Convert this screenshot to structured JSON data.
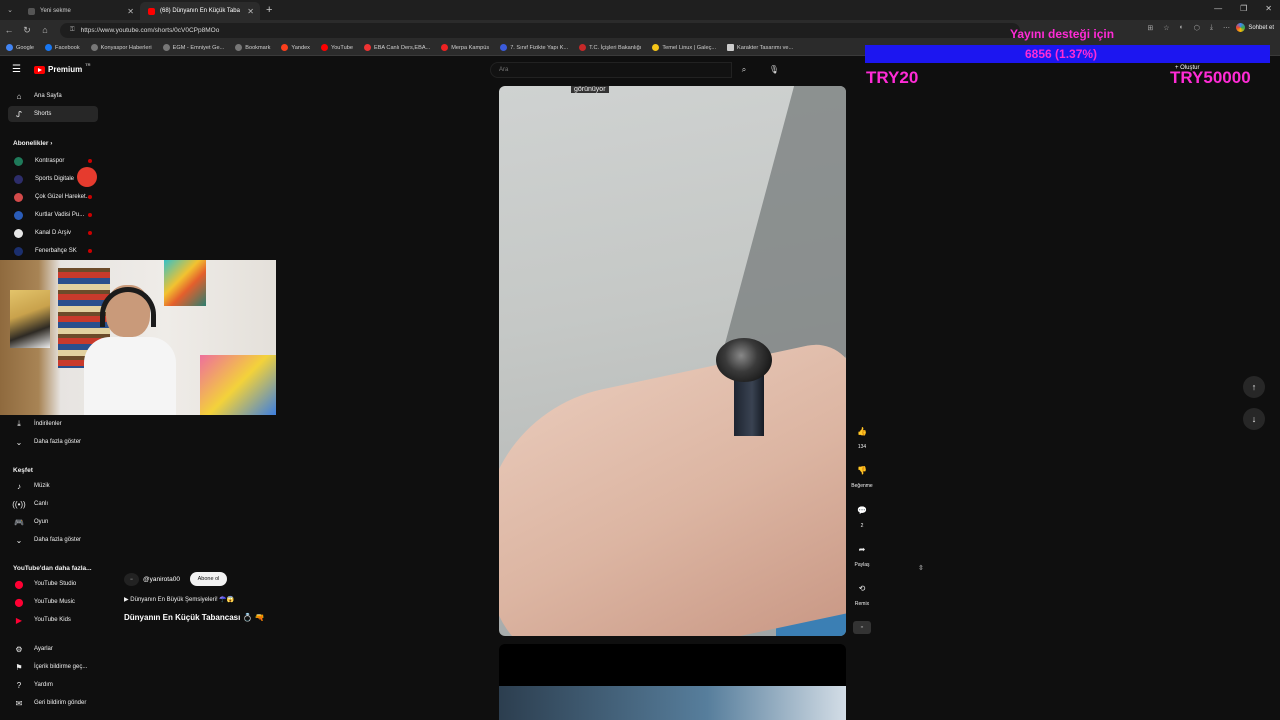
{
  "browser": {
    "tabs": [
      {
        "label": "Yeni sekme",
        "active": false
      },
      {
        "label": "(68) Dünyanın En Küçük Taba",
        "active": true
      }
    ],
    "url": "https://www.youtube.com/shorts/0cV0CPp8MOo",
    "bookmarks": [
      "Google",
      "Facebook",
      "Konyaspor Haberleri",
      "EGM - Emniyet Ge...",
      "Bookmark",
      "Yandex",
      "YouTube",
      "EBA Canlı Ders,EBA...",
      "Merpa Kampüs",
      "7. Sınıf Fizikte Yapı K...",
      "T.C. İçişleri Bakanlığı",
      "Temel Linux | Galeç...",
      "Karakter Tasarımı ve..."
    ],
    "chat_label": "Sohbet et"
  },
  "youtube": {
    "logo_text": "Premium",
    "logo_sup": "TR",
    "search_placeholder": "Ara",
    "create_label": "Oluştur"
  },
  "sidebar": {
    "home": "Ana Sayfa",
    "shorts": "Shorts",
    "subscriptions_header": "Abonelikler",
    "subscriptions": [
      {
        "name": "Kontraspor",
        "color": "#1f7a5a"
      },
      {
        "name": "Sports Digitale",
        "color": "#2d2d6a"
      },
      {
        "name": "Çok Güzel Hareket...",
        "color": "#d34a4a"
      },
      {
        "name": "Kurtlar Vadisi Pu...",
        "color": "#2a5cb8"
      },
      {
        "name": "Kanal D Arşiv",
        "color": "#e6e6e6"
      },
      {
        "name": "Fenerbahçe SK",
        "color": "#1b2f6e"
      }
    ],
    "downloads": "İndirilenler",
    "show_more": "Daha fazla göster",
    "explore_header": "Keşfet",
    "explore": [
      "Müzik",
      "Canlı",
      "Oyun"
    ],
    "explore_more": "Daha fazla göster",
    "more_header": "YouTube'dan daha fazla...",
    "more_items": [
      "YouTube Studio",
      "YouTube Music",
      "YouTube Kids"
    ],
    "footer": [
      "Ayarlar",
      "İçerik bildirme geç...",
      "Yardım",
      "Geri bildirim gönder"
    ]
  },
  "overlay": {
    "donate_text": "Yayını desteği için",
    "donate_amount": "6856 (1.37%)",
    "code_left": "TRY20",
    "code_right": "TRY50000"
  },
  "video": {
    "caption": "görünüyor",
    "channel_handle": "@yanirota00",
    "subscribe_label": "Abone ol",
    "description": "Dünyanın En Büyük Şemsiyeleri! ☂️😱",
    "title": "Dünyanın En Küçük Tabancası 💍 🔫",
    "likes": "134",
    "dislike_label": "Beğenme",
    "comments": "2",
    "share_label": "Paylaş",
    "remix_label": "Remix"
  }
}
